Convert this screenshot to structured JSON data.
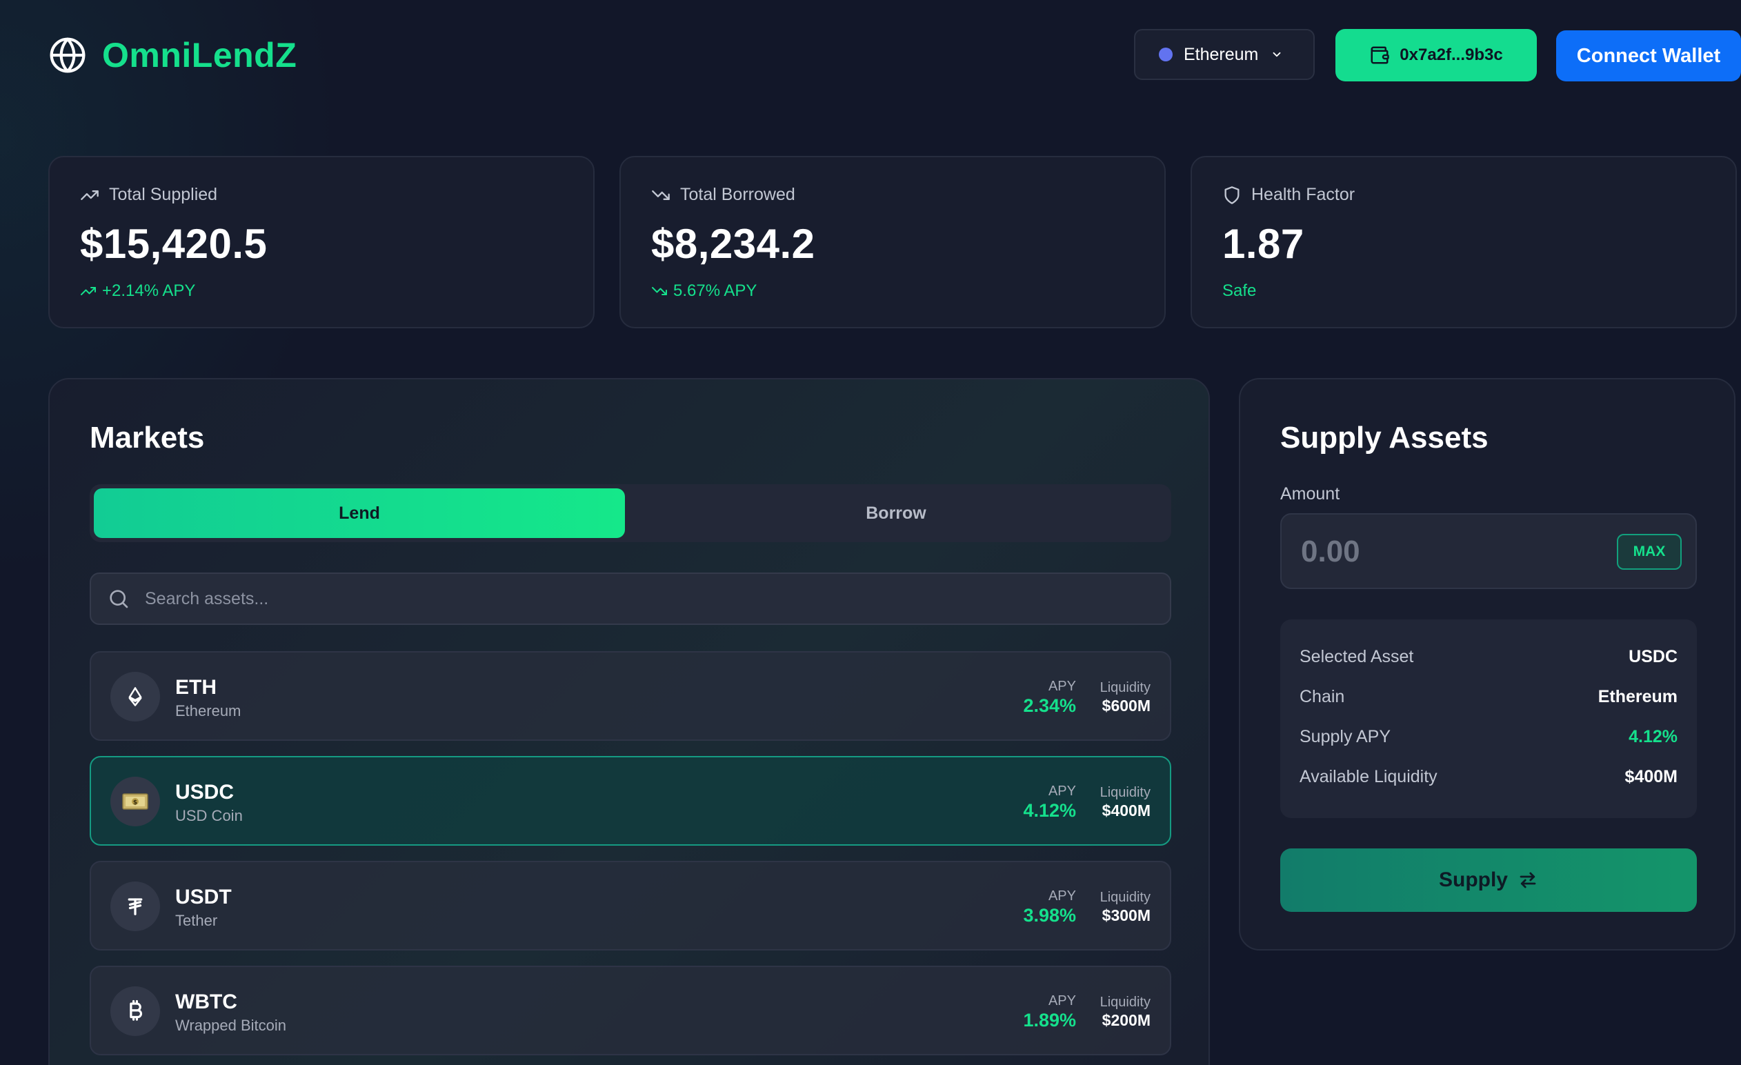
{
  "brand": {
    "name": "OmniLendZ",
    "logo_icon": "globe-icon"
  },
  "header": {
    "network": "Ethereum",
    "network_color": "#6273f0",
    "address": "0x7a2f...9b3c",
    "connect_label": "Connect Wallet"
  },
  "stats": [
    {
      "label": "Total Supplied",
      "value": "$15,420.5",
      "sub": "+2.14% APY",
      "icon": "trending-up-icon"
    },
    {
      "label": "Total Borrowed",
      "value": "$8,234.2",
      "sub": "5.67% APY",
      "icon": "trending-down-icon"
    },
    {
      "label": "Health Factor",
      "value": "1.87",
      "sub": "Safe",
      "icon": "shield-icon"
    }
  ],
  "markets": {
    "title": "Markets",
    "tabs": {
      "lend": "Lend",
      "borrow": "Borrow",
      "active": "Lend"
    },
    "search_placeholder": "Search assets...",
    "apy_label": "APY",
    "liquidity_label": "Liquidity",
    "assets": [
      {
        "symbol": "ETH",
        "name": "Ethereum",
        "apy": "2.34%",
        "liquidity": "$600M",
        "icon": "ethereum-icon"
      },
      {
        "symbol": "USDC",
        "name": "USD Coin",
        "apy": "4.12%",
        "liquidity": "$400M",
        "icon": "dollar-bill-icon",
        "selected": true
      },
      {
        "symbol": "USDT",
        "name": "Tether",
        "apy": "3.98%",
        "liquidity": "$300M",
        "icon": "tether-icon"
      },
      {
        "symbol": "WBTC",
        "name": "Wrapped Bitcoin",
        "apy": "1.89%",
        "liquidity": "$200M",
        "icon": "bitcoin-icon"
      }
    ]
  },
  "supply": {
    "title": "Supply Assets",
    "amount_label": "Amount",
    "amount_placeholder": "0.00",
    "max_label": "MAX",
    "details": [
      {
        "key": "Selected Asset",
        "value": "USDC"
      },
      {
        "key": "Chain",
        "value": "Ethereum"
      },
      {
        "key": "Supply APY",
        "value": "4.12%"
      },
      {
        "key": "Available Liquidity",
        "value": "$400M"
      }
    ],
    "button_label": "Supply"
  },
  "colors": {
    "accent": "#15e08c",
    "primary_blue": "#0d6ef8",
    "background": "#121729"
  }
}
